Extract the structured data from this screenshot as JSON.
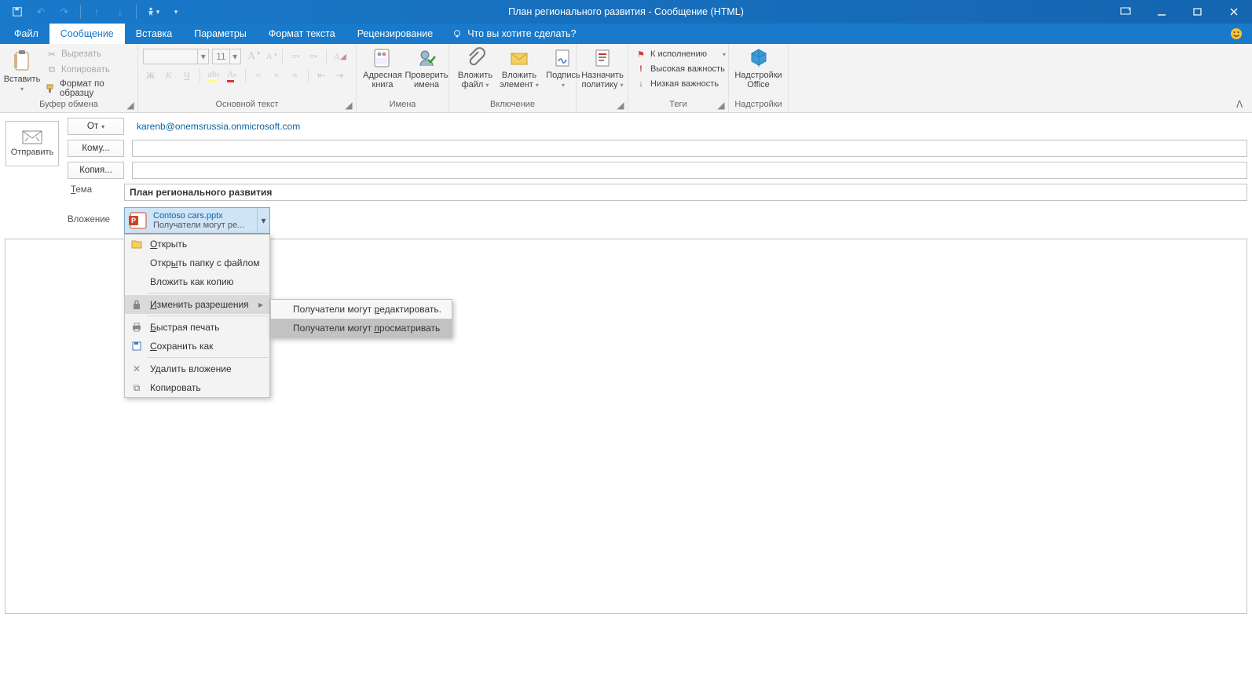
{
  "window": {
    "title": "План регионального развития - Сообщение (HTML)"
  },
  "tabs": {
    "file": "Файл",
    "message": "Сообщение",
    "insert": "Вставка",
    "options": "Параметры",
    "format": "Формат текста",
    "review": "Рецензирование",
    "tell_me": "Что вы хотите сделать?"
  },
  "ribbon": {
    "clipboard": {
      "title": "Буфер обмена",
      "paste": "Вставить",
      "cut": "Вырезать",
      "copy": "Копировать",
      "format_painter": "Формат по образцу"
    },
    "font": {
      "title": "Основной текст",
      "size": "11"
    },
    "names": {
      "title": "Имена",
      "address_book": "Адресная книга",
      "check_names": "Проверить имена"
    },
    "include": {
      "title": "Включение",
      "attach_file": "Вложить файл",
      "attach_item": "Вложить элемент",
      "signature": "Подпись"
    },
    "policy": {
      "assign": "Назначить политику"
    },
    "tags": {
      "title": "Теги",
      "follow_up": "К исполнению",
      "high": "Высокая важность",
      "low": "Низкая важность"
    },
    "addins": {
      "title": "Надстройки",
      "office": "Надстройки Office"
    }
  },
  "compose": {
    "send": "Отправить",
    "from_btn": "От",
    "from_value": "karenb@onemsrussia.onmicrosoft.com",
    "to_btn": "Кому...",
    "cc_btn": "Копия...",
    "subject_label": "Тема",
    "subject_value": "План регионального развития",
    "attach_label": "Вложение",
    "attachment": {
      "name": "Contoso cars.pptx",
      "subline": "Получатели могут ре..."
    }
  },
  "context_menu": {
    "open": "Открыть",
    "open_folder": "Открыть папку с файлом",
    "attach_as_copy": "Вложить как копию",
    "change_permissions": "Изменить разрешения",
    "quick_print": "Быстрая печать",
    "save_as": "Сохранить как",
    "delete": "Удалить вложение",
    "copy": "Копировать",
    "submenu": {
      "can_edit": "Получатели могут редактировать.",
      "can_view": "Получатели могут просматривать"
    }
  }
}
